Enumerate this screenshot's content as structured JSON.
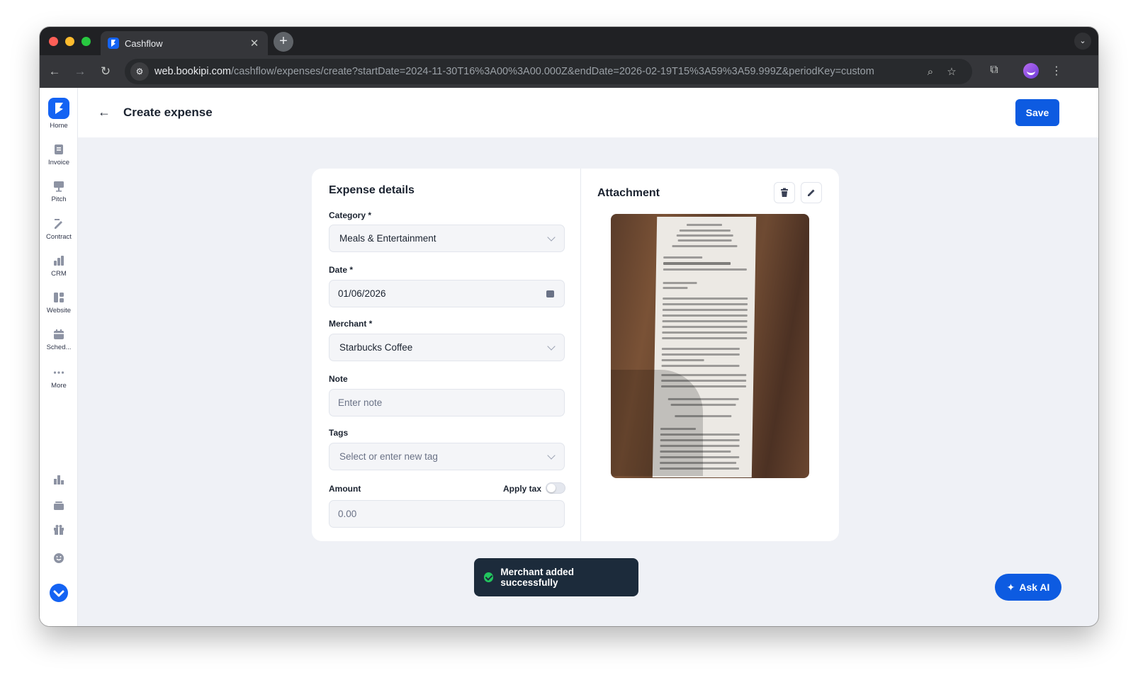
{
  "browser": {
    "tab_title": "Cashflow",
    "url_host": "web.bookipi.com",
    "url_path": "/cashflow/expenses/create?startDate=2024-11-30T16%3A00%3A00.000Z&endDate=2026-02-19T15%3A59%3A59.999Z&periodKey=custom"
  },
  "sidebar": {
    "items": [
      {
        "label": "Home",
        "icon": "bookipi-logo-icon"
      },
      {
        "label": "Invoice",
        "icon": "invoice-icon"
      },
      {
        "label": "Pitch",
        "icon": "pitch-icon"
      },
      {
        "label": "Contract",
        "icon": "contract-icon"
      },
      {
        "label": "CRM",
        "icon": "crm-icon"
      },
      {
        "label": "Website",
        "icon": "website-icon"
      },
      {
        "label": "Sched...",
        "icon": "schedule-icon"
      },
      {
        "label": "More",
        "icon": "more-icon"
      }
    ],
    "bottom_icons": [
      "reports-icon",
      "cashflow-icon",
      "gift-icon",
      "support-icon",
      "profile-icon"
    ]
  },
  "header": {
    "title": "Create expense",
    "save_label": "Save"
  },
  "expense_details": {
    "title": "Expense details",
    "category": {
      "label": "Category *",
      "value": "Meals & Entertainment"
    },
    "date": {
      "label": "Date *",
      "value": "01/06/2026"
    },
    "merchant": {
      "label": "Merchant *",
      "value": "Starbucks Coffee"
    },
    "note": {
      "label": "Note",
      "placeholder": "Enter note"
    },
    "tags": {
      "label": "Tags",
      "placeholder": "Select or enter new tag"
    },
    "amount": {
      "label": "Amount",
      "placeholder": "0.00"
    },
    "apply_tax": {
      "label": "Apply tax",
      "enabled": false
    }
  },
  "attachment": {
    "title": "Attachment"
  },
  "toast": {
    "message": "Merchant added successfully"
  },
  "ask_ai": {
    "label": "Ask AI"
  },
  "colors": {
    "accent": "#0d5be1",
    "toast_bg": "#1c2b3b",
    "success": "#22c55e",
    "page_bg": "#eff1f6"
  }
}
